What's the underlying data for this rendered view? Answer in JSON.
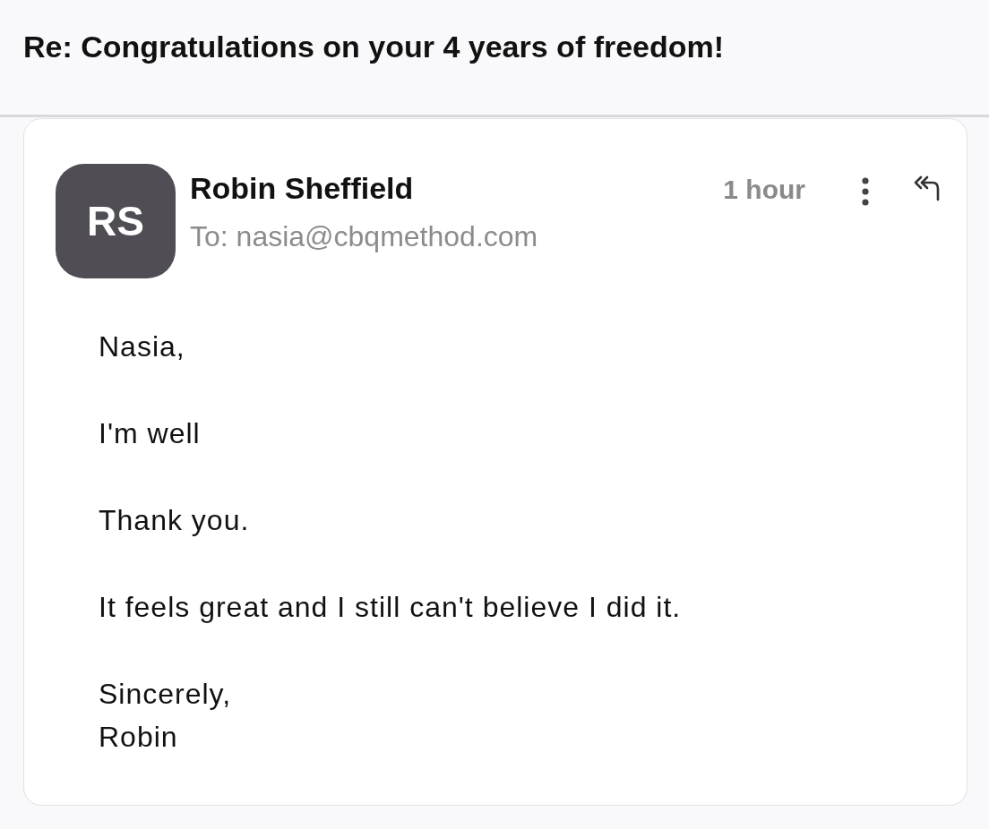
{
  "subject": "Re: Congratulations on your 4 years of freedom!",
  "message": {
    "avatar_initials": "RS",
    "sender": "Robin Sheffield",
    "recipient": "To: nasia@cbqmethod.com",
    "time": "1 hour",
    "paragraphs": [
      [
        "Nasia,"
      ],
      [
        "I'm well"
      ],
      [
        "Thank you."
      ],
      [
        "It feels great and I still can't believe I did it."
      ],
      [
        "Sincerely,",
        "Robin"
      ]
    ]
  }
}
